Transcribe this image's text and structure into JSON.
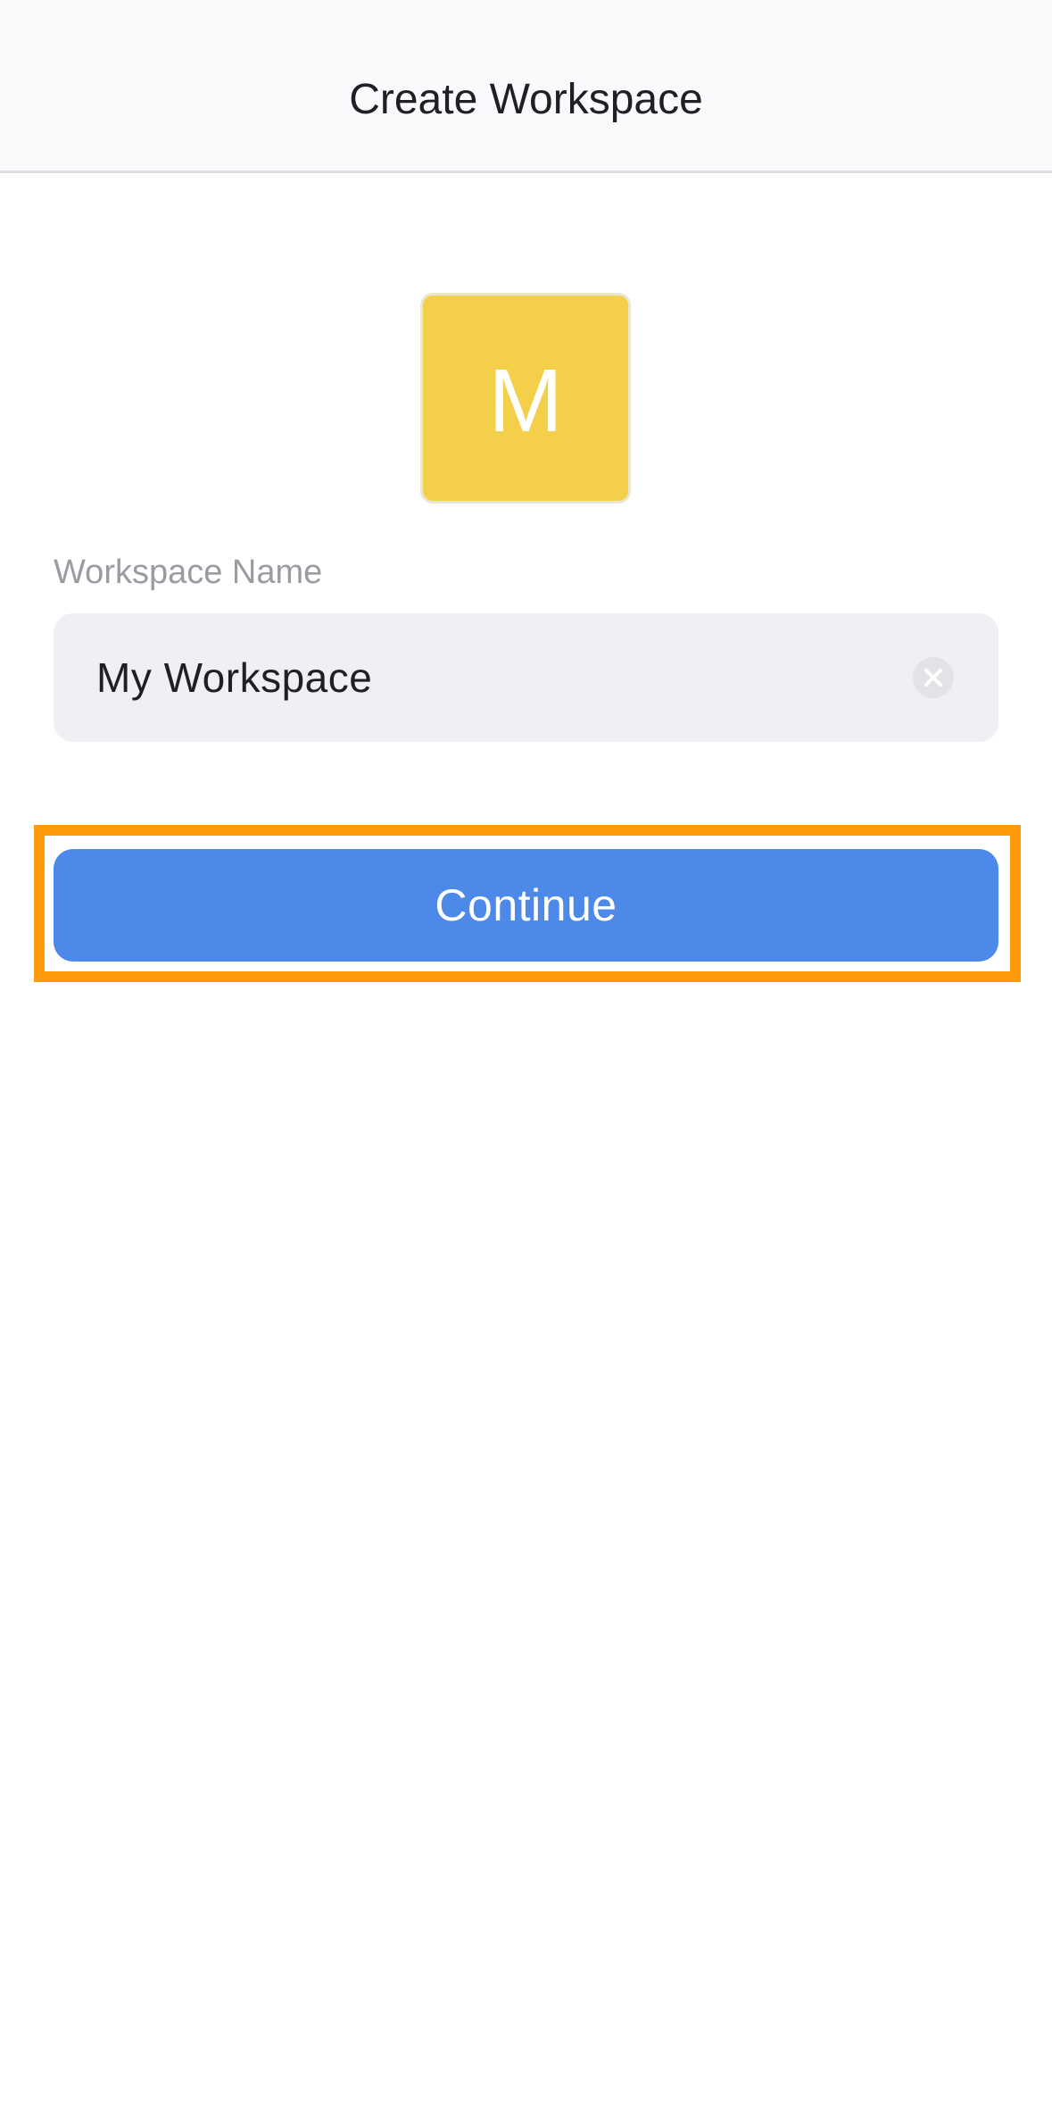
{
  "header": {
    "title": "Create Workspace"
  },
  "avatar": {
    "letter": "M",
    "color": "#f4d04a"
  },
  "form": {
    "label": "Workspace Name",
    "value": "My Workspace",
    "clear_icon": "clear-circle-icon"
  },
  "actions": {
    "continue_label": "Continue",
    "continue_color": "#4c89e8",
    "highlight_color": "#ff9a0b"
  }
}
